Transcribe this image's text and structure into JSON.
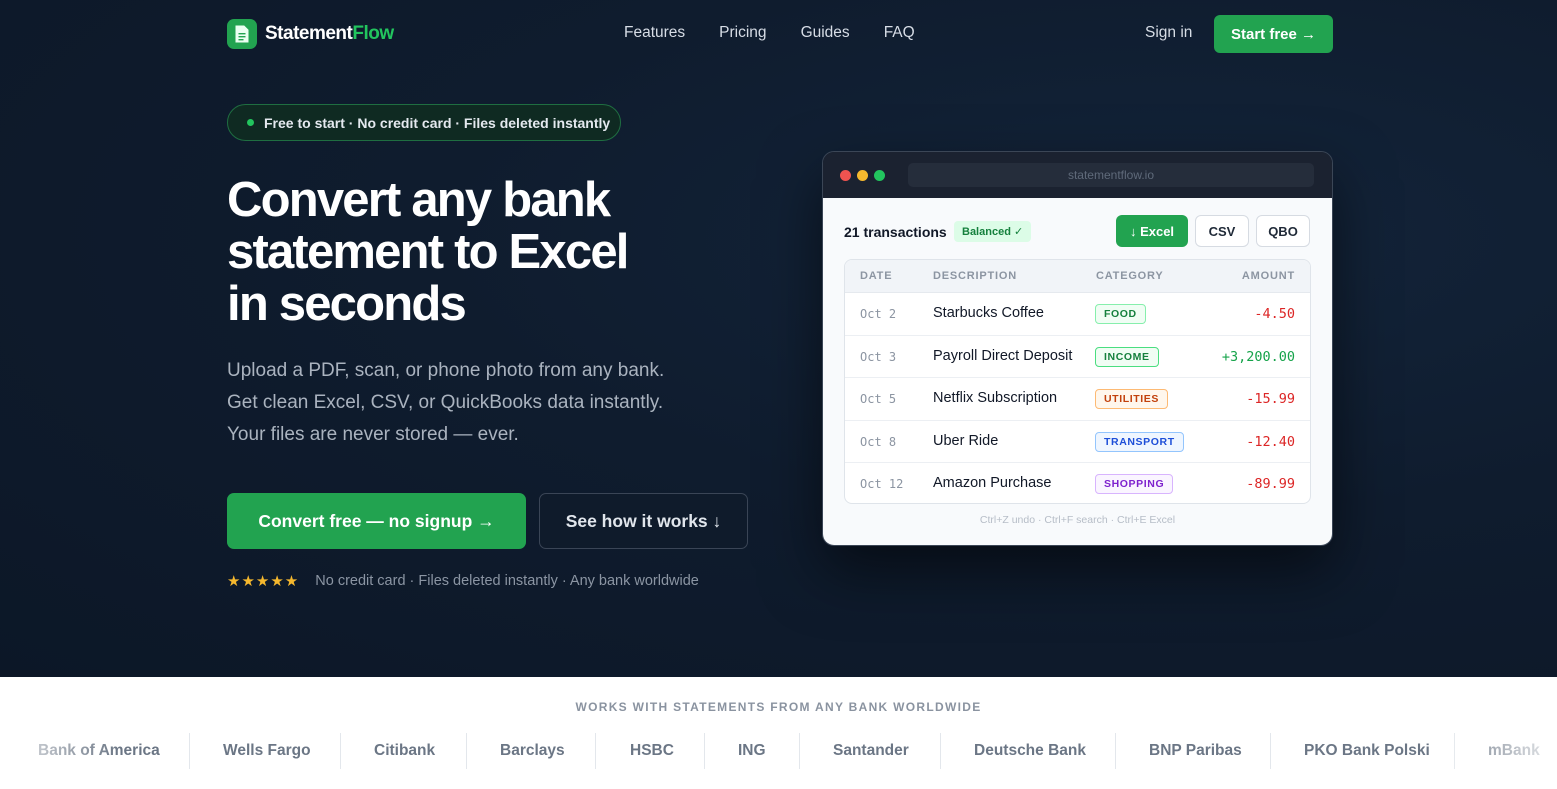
{
  "brand": {
    "name_main": "Statement",
    "name_accent": "Flow"
  },
  "nav": {
    "links": [
      "Features",
      "Pricing",
      "Guides",
      "FAQ"
    ],
    "sign_in": "Sign in",
    "start": "Start free →"
  },
  "hero": {
    "pill": "Free to start · No credit card · Files deleted instantly",
    "headline_lines": [
      "Convert any bank",
      "statement to Excel",
      "in seconds"
    ],
    "sub_lines": [
      "Upload a PDF, scan, or phone photo from any bank.",
      "Get clean Excel, CSV, or QuickBooks data instantly.",
      "Your files are never stored — ever."
    ],
    "cta_primary": "Convert free — no signup →",
    "cta_secondary": "See how it works ↓",
    "stars": "★★★★★",
    "trust": "No credit card · Files deleted instantly · Any bank worldwide"
  },
  "app": {
    "url": "statementflow.io",
    "transactions": "21 transactions",
    "balanced": "Balanced ✓",
    "export_excel": "↓ Excel",
    "export_csv": "CSV",
    "export_qbo": "QBO",
    "columns": [
      "DATE",
      "DESCRIPTION",
      "CATEGORY",
      "AMOUNT"
    ],
    "rows": [
      {
        "date": "Oct 2",
        "desc": "Starbucks Coffee",
        "cat": "FOOD",
        "amount": "-4.50"
      },
      {
        "date": "Oct 3",
        "desc": "Payroll Direct Deposit",
        "cat": "INCOME",
        "amount": "+3,200.00"
      },
      {
        "date": "Oct 5",
        "desc": "Netflix Subscription",
        "cat": "UTILITIES",
        "amount": "-15.99"
      },
      {
        "date": "Oct 8",
        "desc": "Uber Ride",
        "cat": "TRANSPORT",
        "amount": "-12.40"
      },
      {
        "date": "Oct 12",
        "desc": "Amazon Purchase",
        "cat": "SHOPPING",
        "amount": "-89.99"
      }
    ],
    "shortcuts": "Ctrl+Z undo · Ctrl+F search · Ctrl+E Excel"
  },
  "banks": {
    "title": "WORKS WITH STATEMENTS FROM ANY BANK WORLDWIDE",
    "items": [
      "Bank of America",
      "Wells Fargo",
      "Citibank",
      "Barclays",
      "HSBC",
      "ING",
      "Santander",
      "Deutsche Bank",
      "BNP Paribas",
      "PKO Bank Polski",
      "mBank"
    ]
  },
  "colors": {
    "accent": "#22a350",
    "background": "#0f1c2e",
    "negative": "#dc2626",
    "positive": "#16a34a"
  }
}
